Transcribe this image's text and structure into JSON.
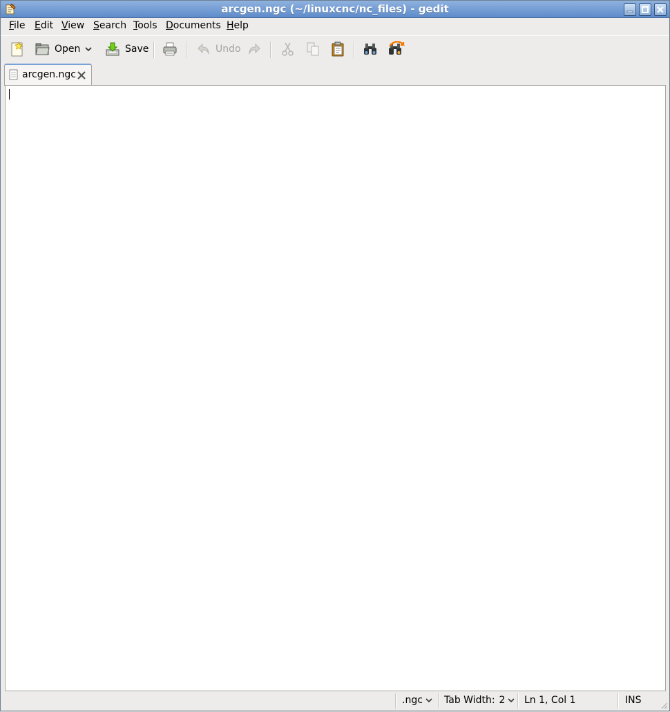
{
  "window": {
    "title": "arcgen.ngc (~/linuxcnc/nc_files) - gedit"
  },
  "menubar": {
    "items": [
      {
        "mnemonic": "F",
        "rest": "ile"
      },
      {
        "mnemonic": "E",
        "rest": "dit"
      },
      {
        "mnemonic": "V",
        "rest": "iew"
      },
      {
        "mnemonic": "S",
        "rest": "earch"
      },
      {
        "mnemonic": "T",
        "rest": "ools"
      },
      {
        "mnemonic": "D",
        "rest": "ocuments"
      },
      {
        "mnemonic": "H",
        "rest": "elp"
      }
    ]
  },
  "toolbar": {
    "open_label": "Open",
    "save_label": "Save",
    "undo_label": "Undo"
  },
  "tabs": [
    {
      "label": "arcgen.ngc"
    }
  ],
  "editor": {
    "content": ""
  },
  "statusbar": {
    "language": ".ngc",
    "tab_width_label": "Tab Width:",
    "tab_width_value": "2",
    "position": "Ln 1, Col 1",
    "mode": "INS"
  },
  "colors": {
    "titlebar": "#5e8ccb",
    "tab_accent": "#7aa2d4"
  }
}
